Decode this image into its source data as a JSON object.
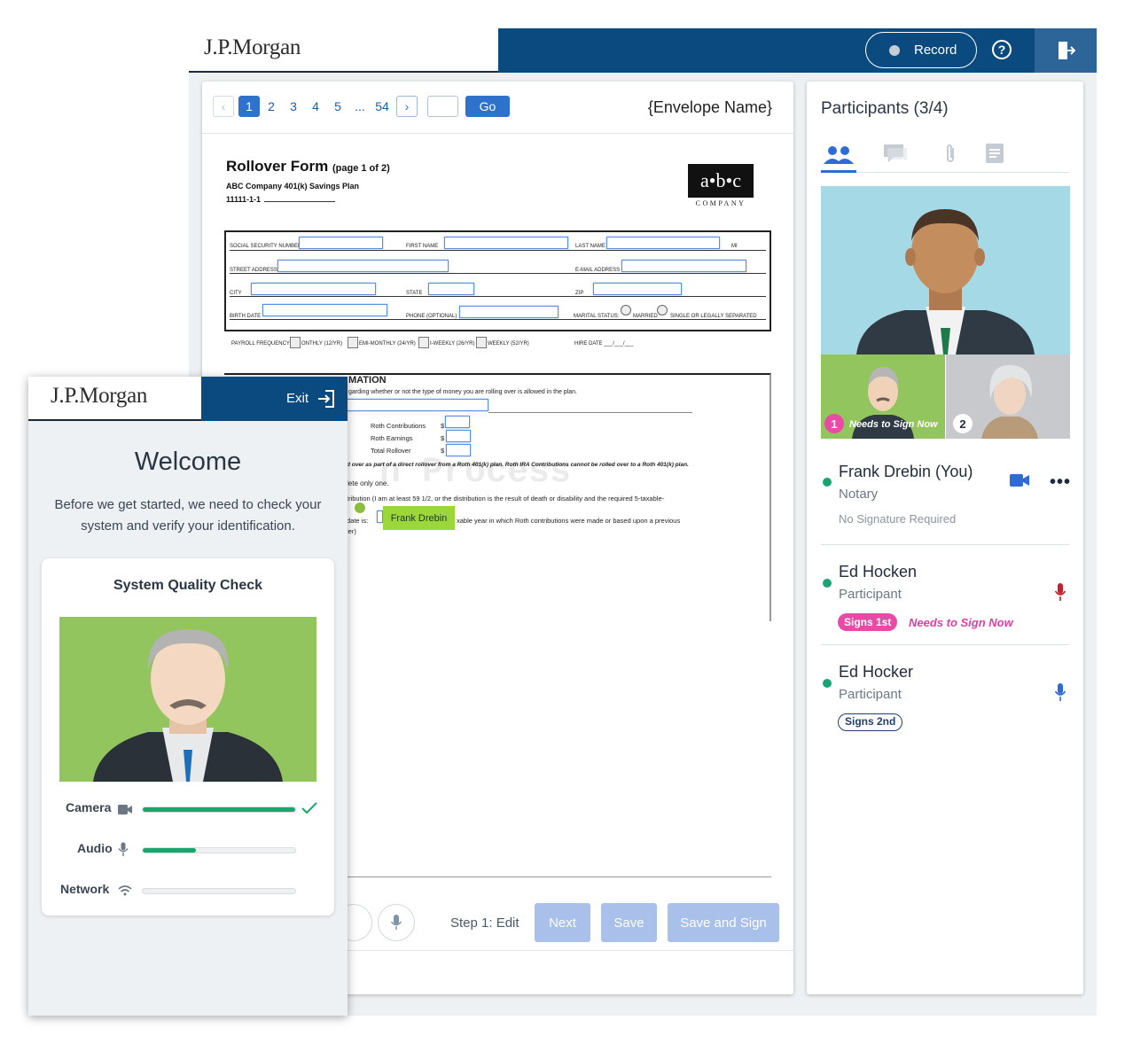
{
  "brand": {
    "logo_text": "J.P.Morgan",
    "primary_color": "#0b4a7e",
    "accent_color": "#2f72cc"
  },
  "topbar": {
    "record_label": "Record",
    "help_icon": "help-icon",
    "exit_icon": "exit-door-icon"
  },
  "pager": {
    "pages": [
      "1",
      "2",
      "3",
      "4",
      "5",
      "...",
      "54"
    ],
    "active_page": "1",
    "go_label": "Go",
    "jump_value": ""
  },
  "envelope_name": "{Envelope Name}",
  "document": {
    "title": "Rollover Form",
    "title_suffix": "(page 1 of 2)",
    "plan_name": "ABC Company 401(k) Savings Plan",
    "account_number": "11111-1-1",
    "company_logo": "a•b•c",
    "company_sub": "COMPANY",
    "fields": {
      "ssn": "SOCIAL SECURITY NUMBER",
      "first_name": "FIRST NAME",
      "last_name": "LAST NAME",
      "mi": "MI",
      "street": "STREET ADDRESS",
      "email": "E-MAIL ADDRESS",
      "city": "CITY",
      "state": "STATE",
      "zip": "ZIP",
      "birth_date": "BIRTH DATE",
      "phone": "PHONE (OPTIONAL)",
      "marital_status": "MARITAL STATUS:",
      "married": "MARRIED",
      "single": "SINGLE OR LEGALLY SEPARATED"
    },
    "payroll": {
      "label": "PAYROLL FREQUENCY:",
      "options": [
        "ONTHLY (12/YR)",
        "EMI-MONTHLY (24/YR)",
        "I-WEEKLY (26/YR)",
        "WEEKLY (52/YR)"
      ],
      "hire_date": "HIRE DATE ___/___/___"
    },
    "section2": {
      "heading": "MATION",
      "line1": "garding whether or not the type of money you are rolling over is allowed in the plan.",
      "roth_contrib": "Roth Contributions",
      "roth_earnings": "Roth Earnings",
      "total_rollover": "Total Rollover",
      "dollar": "$",
      "bold_note": "d over as part of a direct rollover from a Roth 401(k) plan. Roth IRA Contributions cannot be rolled over to a Roth 401(k) plan.",
      "line_one": "lete only one.",
      "line_dist": "tribution (I am at least 59 1/2, or the distribution is the result of death or disability and the required 5-taxable-",
      "line_date": "date is:",
      "line_taxable": "xable year in which Roth contributions were made or based upon a previous",
      "line_ier": "ier)"
    },
    "watermark": "n Process",
    "signer_tag": "Frank Drebin"
  },
  "action_bar": {
    "step_label": "Step 1: Edit",
    "next_label": "Next",
    "save_label": "Save",
    "save_sign_label": "Save and Sign"
  },
  "participants": {
    "title": "Participants (3/4)",
    "thumb1": {
      "badge": "1",
      "text": "Needs to Sign Now"
    },
    "thumb2": {
      "badge": "2"
    },
    "list": [
      {
        "name": "Frank Drebin (You)",
        "role": "Notary",
        "note": "No Signature Required"
      },
      {
        "name": "Ed Hocken",
        "role": "Participant",
        "badge": "Signs 1st",
        "status": "Needs to Sign Now"
      },
      {
        "name": "Ed Hocker",
        "role": "Participant",
        "badge": "Signs 2nd"
      }
    ]
  },
  "overlay": {
    "exit_label": "Exit",
    "welcome": "Welcome",
    "welcome_text": "Before we get started, we need to check your system and verify your identification.",
    "check_title": "System Quality Check",
    "checks": [
      {
        "label": "Camera",
        "progress": 1.0
      },
      {
        "label": "Audio",
        "progress": 0.35
      },
      {
        "label": "Network",
        "progress": 0.0
      }
    ]
  }
}
